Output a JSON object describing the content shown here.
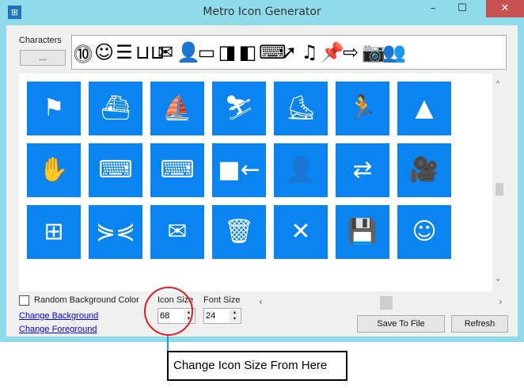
{
  "window": {
    "title": "Metro Icon Generator",
    "minimize": "–",
    "maximize": "☐",
    "close": "✕",
    "app_icon": "⊞"
  },
  "characters": {
    "label": "Characters",
    "button": "...",
    "strip": [
      "⓾",
      "☺",
      "☰",
      "⊔⊔",
      "✉",
      "👤",
      "▭",
      "◨",
      "◧",
      "⌨",
      "➚",
      "♫",
      "📌",
      "⇨",
      "📷",
      "👥"
    ]
  },
  "tiles": [
    "⚑",
    "⛴",
    "⛵",
    "⛷",
    "⛸",
    "🏃",
    "▲",
    "✋",
    "⌨",
    "⌨",
    "■←",
    "👤",
    "⇄",
    "🎥",
    "⊞",
    "⋟⋞",
    "✉",
    "🗑",
    "✕",
    "💾",
    "☺"
  ],
  "tile_color": "#0a84f0",
  "options": {
    "random_bg": "Random Background Color",
    "change_bg": "Change Background",
    "change_fg": "Change Foreground",
    "icon_size_label": "Icon Size",
    "icon_size": "68",
    "font_size_label": "Font Size",
    "font_size": "24"
  },
  "buttons": {
    "save": "Save To File",
    "refresh": "Refresh"
  },
  "annotation": "Change Icon Size From Here"
}
